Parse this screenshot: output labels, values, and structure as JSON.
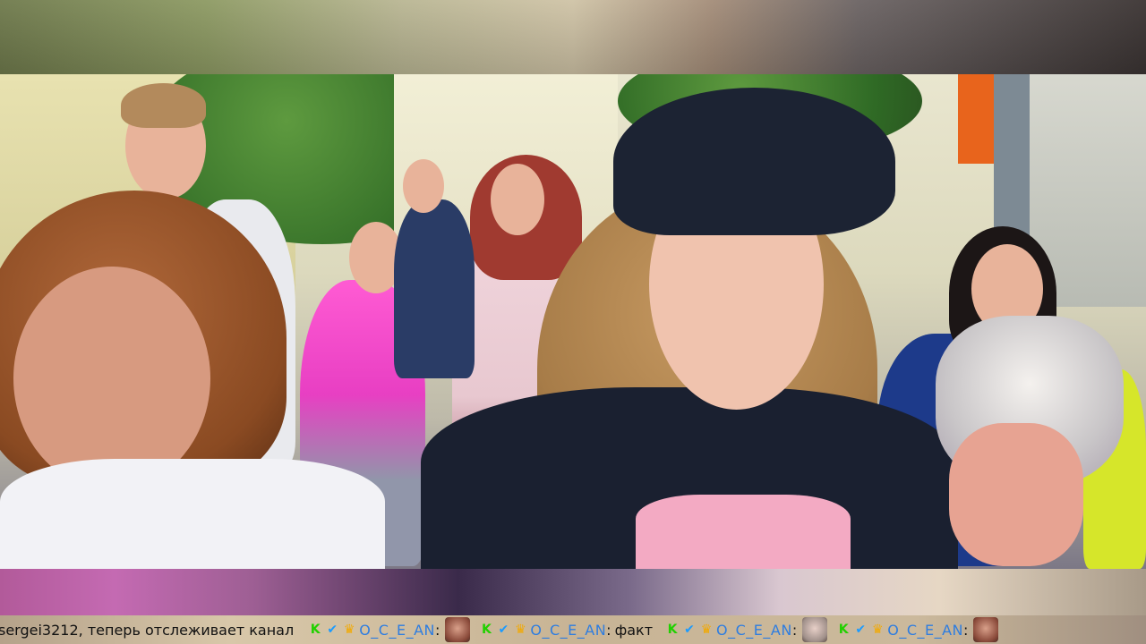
{
  "ticker": {
    "follow_message": "sergei3212, теперь отслеживает канал",
    "entries": [
      {
        "user": "O_C_E_AN",
        "separator": ":",
        "text": "",
        "emote": "face-emote"
      },
      {
        "user": "O_C_E_AN",
        "separator": ":",
        "text": "факт",
        "emote": ""
      },
      {
        "user": "O_C_E_AN",
        "separator": ":",
        "text": "",
        "emote": "face-emote"
      },
      {
        "user": "O_C_E_AN",
        "separator": ":",
        "text": "",
        "emote": "face-emote"
      }
    ],
    "badges": [
      "k-badge-icon",
      "check-badge-icon",
      "crown-badge-icon"
    ],
    "colors": {
      "username": "#2e7de0",
      "k_badge": "#21d000",
      "check_badge": "#1b9bff",
      "crown_badge": "#f2a900"
    }
  }
}
